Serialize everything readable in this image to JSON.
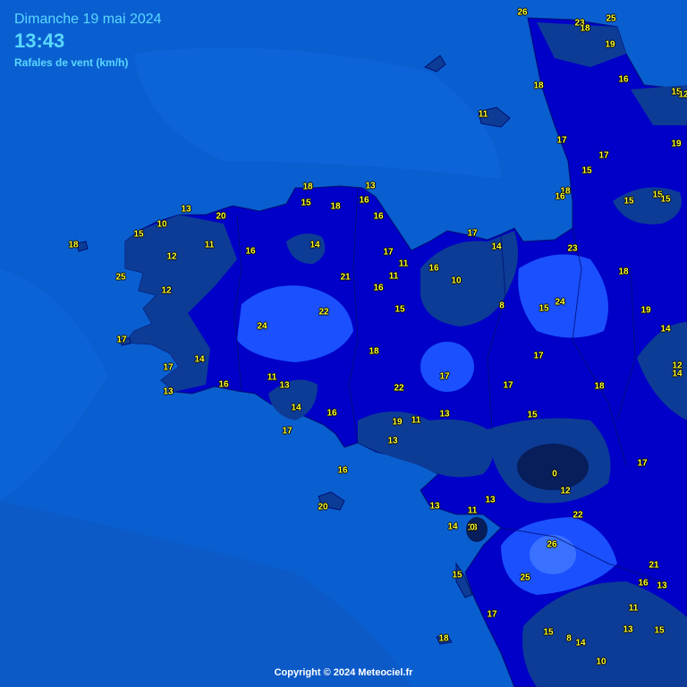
{
  "header": {
    "date": "Dimanche 19 mai 2024",
    "time": "13:43",
    "subtitle": "Rafales de vent (km/h)"
  },
  "footer": {
    "copyright": "Copyright © 2024 Meteociel.fr"
  },
  "colors": {
    "sea": "#0a5fd0",
    "land_base": "#0000c8",
    "gust_low_zone": "#0d3c96",
    "gust_calm_zone": "#071e5a",
    "gust_high_zone": "#1b50ff",
    "label_text": "#ffff33",
    "header_text": "#5ad8ff"
  },
  "stations": [
    "26",
    "23",
    "18",
    "25",
    "19",
    "16",
    "15",
    "12",
    "18",
    "11",
    "17",
    "17",
    "15",
    "18",
    "16",
    "15",
    "15",
    "15",
    "19",
    "13",
    "18",
    "13",
    "16",
    "18",
    "15",
    "16",
    "10",
    "20",
    "15",
    "11",
    "16",
    "14",
    "18",
    "12",
    "25",
    "12",
    "17",
    "11",
    "16",
    "17",
    "14",
    "21",
    "11",
    "17",
    "16",
    "10",
    "23",
    "18",
    "22",
    "24",
    "15",
    "24",
    "15",
    "8",
    "19",
    "14",
    "17",
    "12",
    "14",
    "14",
    "17",
    "18",
    "16",
    "13",
    "11",
    "13",
    "17",
    "18",
    "22",
    "17",
    "15",
    "13",
    "14",
    "16",
    "17",
    "19",
    "11",
    "13",
    "17",
    "0",
    "13",
    "16",
    "12",
    "13",
    "20",
    "14",
    "11",
    "22",
    "13",
    "0",
    "26",
    "25",
    "15",
    "21",
    "16",
    "13",
    "17",
    "11",
    "13",
    "15",
    "15",
    "8",
    "14",
    "18",
    "10"
  ]
}
